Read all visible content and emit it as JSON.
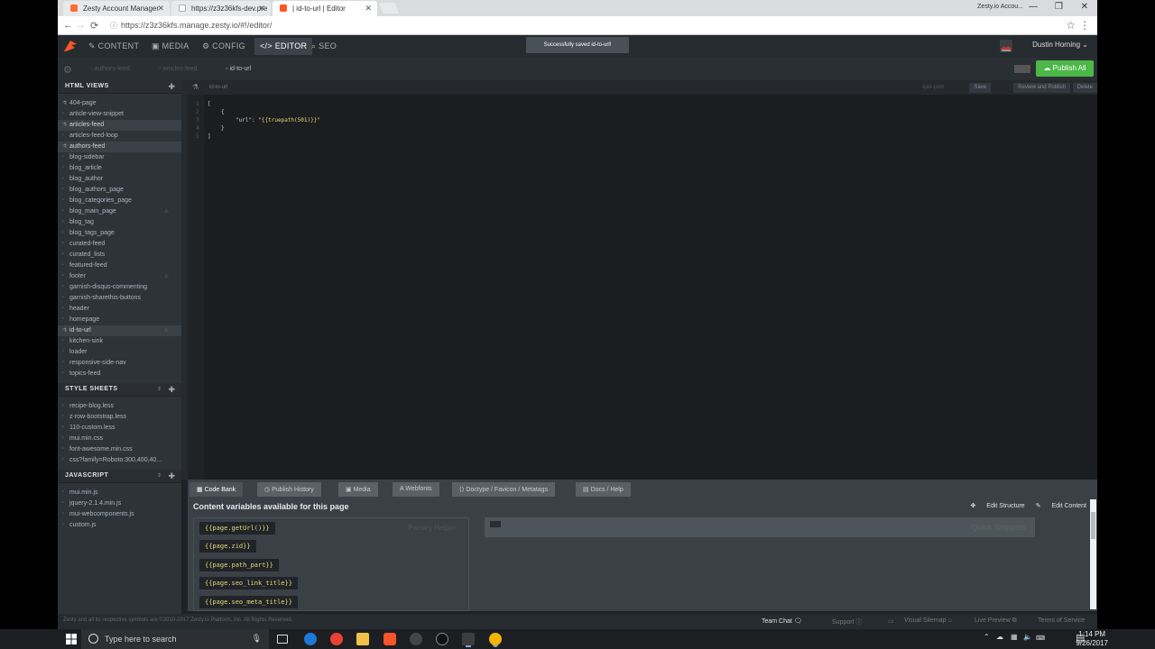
{
  "browser": {
    "tabs": [
      {
        "title": "Zesty Account Manager",
        "fav_color": "#ff6b35"
      },
      {
        "title": "https://z3z36kfs-dev.pre",
        "fav_color": "#999999"
      },
      {
        "title": "| id-to-url | Editor",
        "fav_color": "#ff5722"
      }
    ],
    "profile": "Zesty.io Accou...",
    "url": "https://z3z36kfs.manage.zesty.io/#!/editor/"
  },
  "nav": {
    "items": [
      "CONTENT",
      "MEDIA",
      "CONFIG",
      "EDITOR",
      "SEO"
    ],
    "toast": "Successfully saved id-to-url!",
    "user": "Dustin Horning"
  },
  "subbar": {
    "file_tabs": [
      "authors-feed",
      "articles-feed",
      "id-to-url"
    ],
    "publish_all": "Publish All"
  },
  "sidebar": {
    "html_views_title": "HTML VIEWS",
    "html_views": [
      "404-page",
      "article-view-snippet",
      "articles-feed",
      "articles-feed-loop",
      "authors-feed",
      "blog-sidebar",
      "blog_article",
      "blog_author",
      "blog_authors_page",
      "blog_categories_page",
      "blog_main_page",
      "blog_tag",
      "blog_tags_page",
      "curated-feed",
      "curated_lists",
      "featured-feed",
      "footer",
      "garnish-disqus-commenting",
      "garnish-sharethis-buttons",
      "header",
      "homepage",
      "id-to-url",
      "kitchen-sink",
      "loader",
      "responsive-side-nav",
      "topics-feed"
    ],
    "style_sheets_title": "STYLE SHEETS",
    "style_sheets": [
      "recipe-blog.less",
      "z-row-bootstrap.less",
      "110-custom.less",
      "mui.min.css",
      "font-awesome.min.css",
      "css?family=Roboto:300,400,40..."
    ],
    "javascript_title": "JAVASCRIPT",
    "javascript": [
      "mui.min.js",
      "jquery-2.1.4.min.js",
      "mui-webcomponents.js",
      "custom.js"
    ]
  },
  "editor": {
    "filename": "id-to-url",
    "type": "ajax-json",
    "buttons": [
      "Save",
      "Review and Publish",
      "Delete"
    ],
    "line_numbers": [
      "1",
      "2",
      "3",
      "4",
      "5"
    ],
    "code": {
      "l1": "[",
      "l2": "{",
      "key": "\"url\":",
      "val": "\"{{truepath(501)}}\"",
      "l4": "}",
      "l5": "]"
    }
  },
  "bottom": {
    "tabs": [
      "Code Bank",
      "Publish History",
      "Media",
      "Webfonts",
      "Doctype / Favicon / Metatags",
      "Docs / Help"
    ],
    "heading": "Content variables available for this page",
    "edit_structure": "Edit Structure",
    "edit_content": "Edit Content",
    "helper_label": "Parsley Helper",
    "quick_label": "Quick Snippets",
    "vars": [
      "{{page.getUrl()}}",
      "{{page.zid}}",
      "{{page.path_part}}",
      "{{page.seo_link_title}}",
      "{{page.seo_meta_title}}"
    ]
  },
  "footer": {
    "copyright": "Zesty and all its respective symbols are ©2010-2017 Zesty.io Platform, Inc. All Rights Reserved.",
    "team_chat": "Team Chat",
    "support": "Support",
    "visual_sitemap": "Visual Sitemap",
    "live_preview": "Live Preview",
    "terms": "Terms of Service"
  },
  "taskbar": {
    "search_placeholder": "Type here to search",
    "time": "1:14 PM",
    "date": "9/26/2017"
  },
  "colors": {
    "publish_green": "#4bb848",
    "code_string": "#e6db74",
    "zesty_orange": "#ff5722"
  }
}
